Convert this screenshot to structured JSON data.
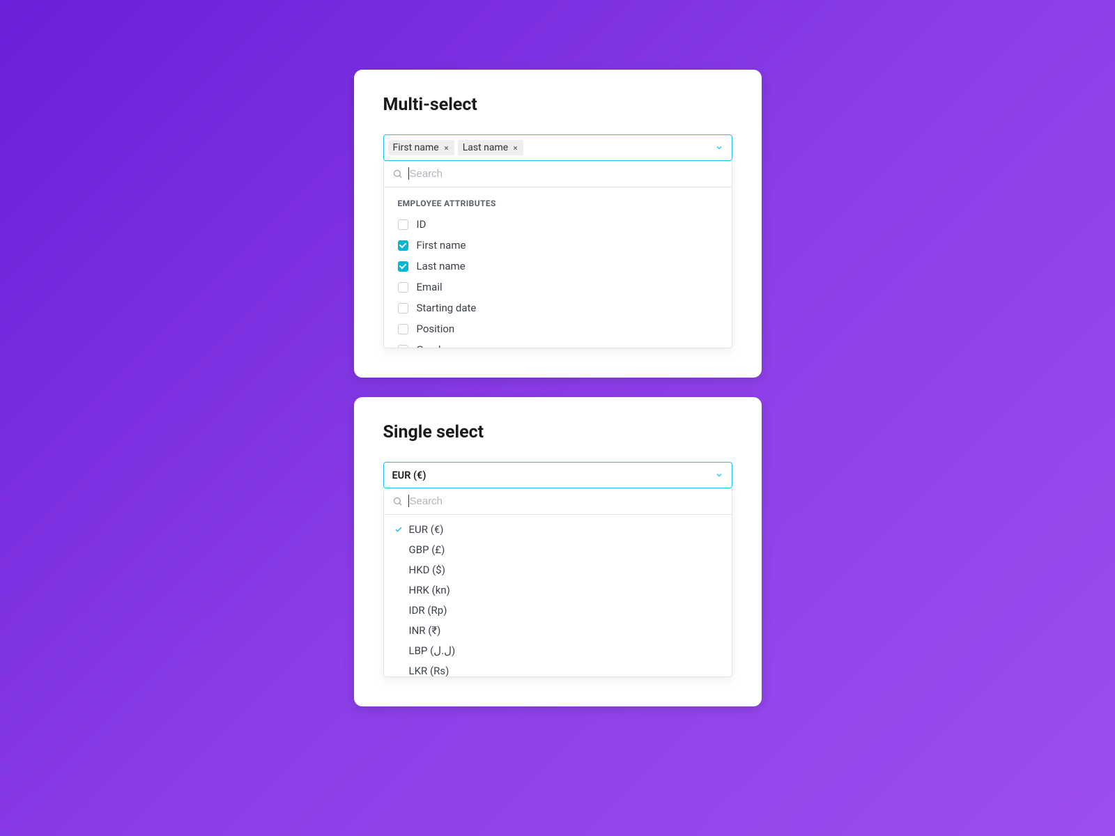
{
  "multiSelect": {
    "title": "Multi-select",
    "chips": [
      "First name",
      "Last name"
    ],
    "searchPlaceholder": "Search",
    "groupHeader": "EMPLOYEE ATTRIBUTES",
    "options": [
      {
        "label": "ID",
        "checked": false
      },
      {
        "label": "First name",
        "checked": true
      },
      {
        "label": "Last name",
        "checked": true
      },
      {
        "label": "Email",
        "checked": false
      },
      {
        "label": "Starting date",
        "checked": false
      },
      {
        "label": "Position",
        "checked": false
      },
      {
        "label": "Gender",
        "checked": false
      }
    ]
  },
  "singleSelect": {
    "title": "Single select",
    "selectedValue": "EUR (€)",
    "searchPlaceholder": "Search",
    "options": [
      {
        "label": "EUR (€)",
        "selected": true
      },
      {
        "label": "GBP (£)",
        "selected": false
      },
      {
        "label": "HKD ($)",
        "selected": false
      },
      {
        "label": "HRK (kn)",
        "selected": false
      },
      {
        "label": "IDR (Rp)",
        "selected": false
      },
      {
        "label": "INR (₹)",
        "selected": false
      },
      {
        "label": "LBP (ل.ل)",
        "selected": false
      },
      {
        "label": "LKR (Rs)",
        "selected": false
      }
    ]
  },
  "colors": {
    "accent": "#1bc2e8",
    "checkboxChecked": "#00b8d4"
  }
}
